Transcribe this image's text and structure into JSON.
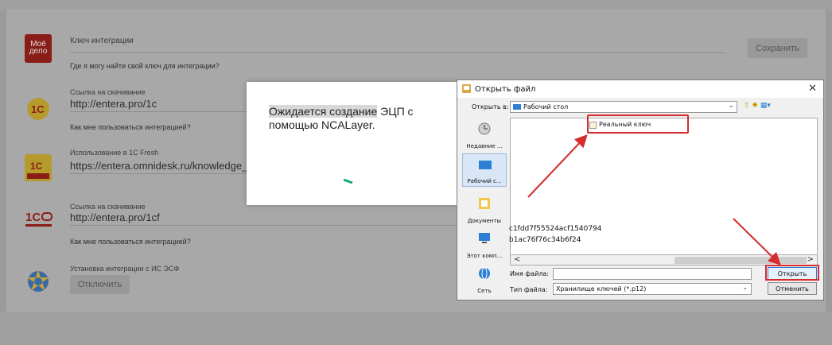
{
  "integrations": [
    {
      "logo_text": "Моё дело",
      "label": "Ключ интеграции",
      "value": "",
      "help": "Где я могу найти свой ключ для интеграции?"
    },
    {
      "label": "Ссылка на скачивание",
      "value": "http://entera.pro/1c",
      "help": "Как мне пользоваться интеграцией?"
    },
    {
      "label": "Использование в 1С Fresh",
      "value": "https://entera.omnidesk.ru/knowledge_base"
    },
    {
      "label": "Ссылка на скачивание",
      "value": "http://entera.pro/1cf",
      "help": "Как мне пользоваться интеграцией?"
    },
    {
      "label": "Установка интеграции с ИС ЭСФ",
      "button": "Отключить"
    }
  ],
  "save_button": "Сохранить",
  "modal": {
    "text_highlight": "Ожидается создание",
    "text_rest": " ЭЦП с помощью NCALayer."
  },
  "file_dialog": {
    "title": "Открыть файл",
    "look_in_label": "Открыть в:",
    "look_in_value": "Рабочий стол",
    "sidebar": [
      {
        "label": "Недавние ...",
        "icon": "recent-icon"
      },
      {
        "label": "Рабочий с...",
        "icon": "desktop-icon"
      },
      {
        "label": "Документы",
        "icon": "documents-icon"
      },
      {
        "label": "Этот комп...",
        "icon": "computer-icon"
      },
      {
        "label": "Сеть",
        "icon": "network-icon"
      }
    ],
    "file": "Реальный ключ",
    "hash_lines": [
      "c1fdd7f55524acf1540794",
      "b1ac76f76c34b6f24"
    ],
    "filename_label": "Имя файла:",
    "filename_value": "",
    "filetype_label": "Тип файла:",
    "filetype_value": "Хранилище ключей (*.p12)",
    "open_button": "Открыть",
    "cancel_button": "Отменить"
  },
  "colors": {
    "accent_red": "#d52d2d",
    "brand_md": "#8a1d17",
    "spinner": "#1aa57a"
  }
}
